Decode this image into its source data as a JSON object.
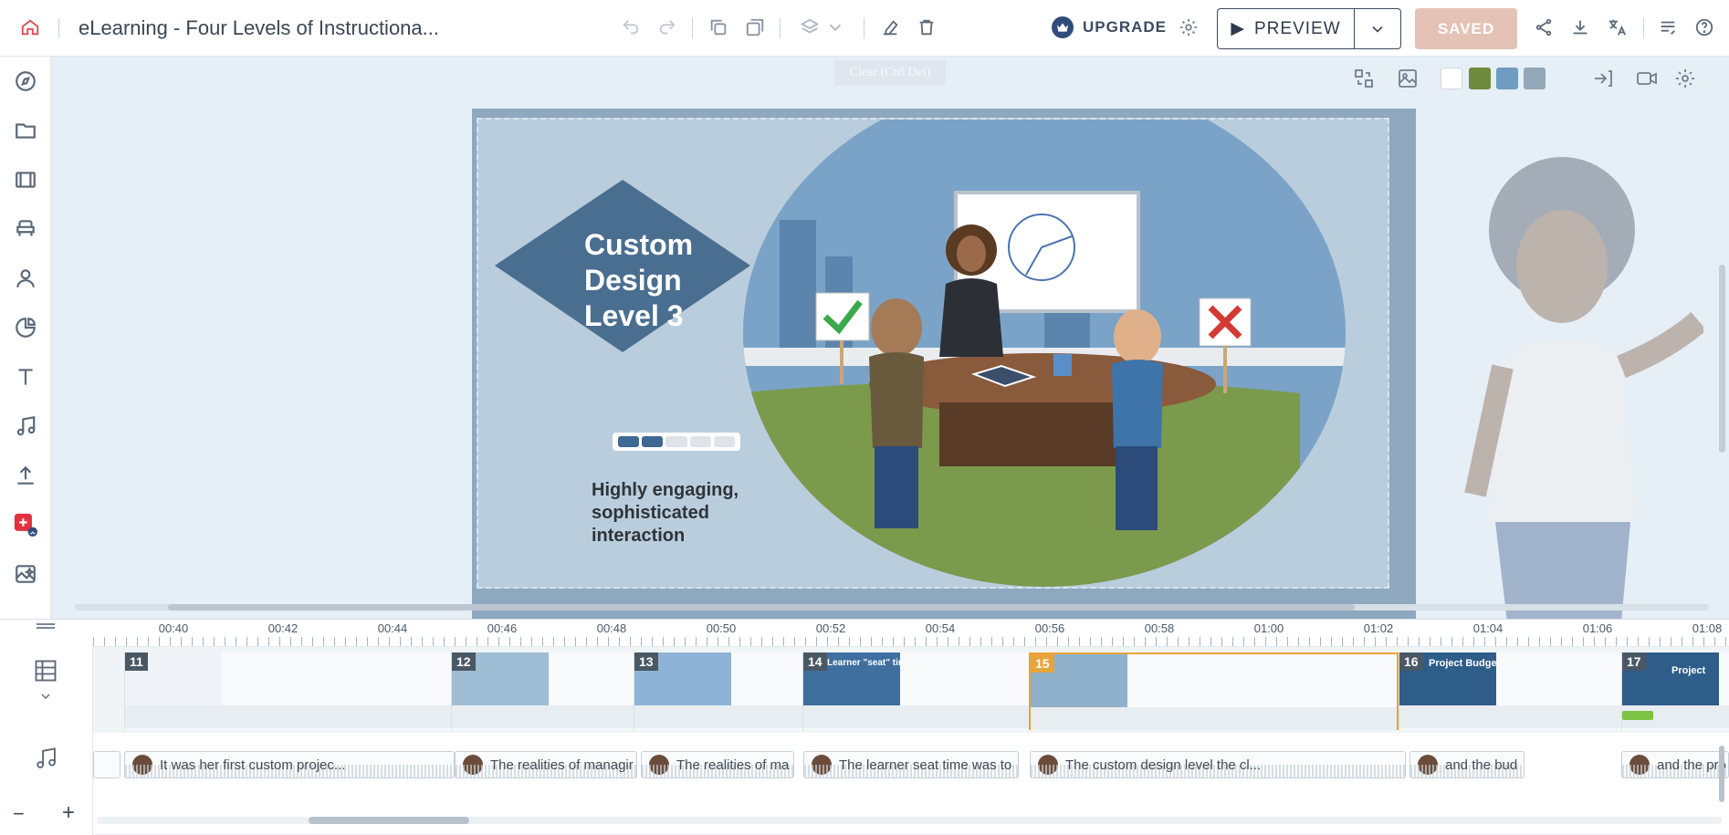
{
  "app": {
    "doc_title": "eLearning - Four Levels of Instructiona...",
    "upgrade_label": "UPGRADE",
    "preview_label": "PREVIEW",
    "saved_label": "SAVED",
    "tooltip": "Clear (Ctrl Del)"
  },
  "toolbar": {
    "swatches": [
      "#ffffff",
      "#6e8b3d",
      "#6f9cc1",
      "#93a8b8"
    ]
  },
  "slide": {
    "title": "Custom Design Level 3",
    "title_lines": [
      "Custom",
      "Design",
      "Level 3"
    ],
    "body": "Highly engaging, sophisticated interaction",
    "progress_filled": 2,
    "progress_total": 5
  },
  "timeline": {
    "ruler": [
      "00:40",
      "00:42",
      "00:44",
      "00:46",
      "00:48",
      "00:50",
      "00:52",
      "00:54",
      "00:56",
      "00:58",
      "01:00",
      "01:02",
      "01:04",
      "01:06",
      "01:08"
    ],
    "scenes": [
      {
        "num": "11",
        "caption": ""
      },
      {
        "num": "12",
        "caption": ""
      },
      {
        "num": "13",
        "caption": ""
      },
      {
        "num": "14",
        "caption": "Learner \"seat\" time"
      },
      {
        "num": "15",
        "caption": ""
      },
      {
        "num": "16",
        "caption": "Project Budget"
      },
      {
        "num": "17",
        "caption": "Project"
      }
    ],
    "audio_clips": [
      "It was her first custom projec...",
      "The realities of managir",
      "The realities of ma",
      "The learner seat time was to",
      "The custom design level the cl...",
      "and the bud",
      "and the pro"
    ]
  }
}
